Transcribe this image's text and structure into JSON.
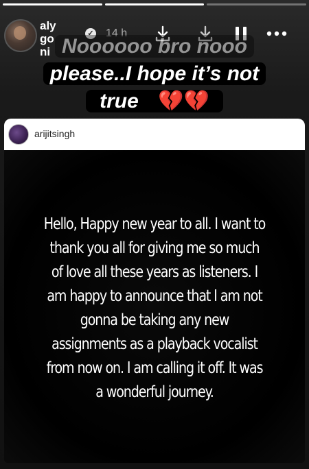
{
  "story": {
    "progress": [
      1,
      1,
      0
    ],
    "username": "alygoni",
    "verified_glyph": "✓",
    "time": "14 h",
    "icons": [
      "download-icon",
      "download-icon",
      "pause-icon",
      "more-icon"
    ],
    "caption_faded": "Noooooo bro nooo",
    "caption_line1": "please..I hope it’s not",
    "caption_line2": "true",
    "caption_emoji": "💔💔"
  },
  "post": {
    "username": "arijitsingh",
    "text": "Hello, Happy new year to all. I want to thank you all for giving me so much of love all these years as listeners. I am happy to announce that I am not gonna be taking any new assignments as a playback vocalist from now on. I am calling it off. It was a wonderful journey."
  },
  "colors": {
    "caption_bg": "#000000",
    "heart": "#e0303a",
    "card_header": "#ffffff"
  }
}
